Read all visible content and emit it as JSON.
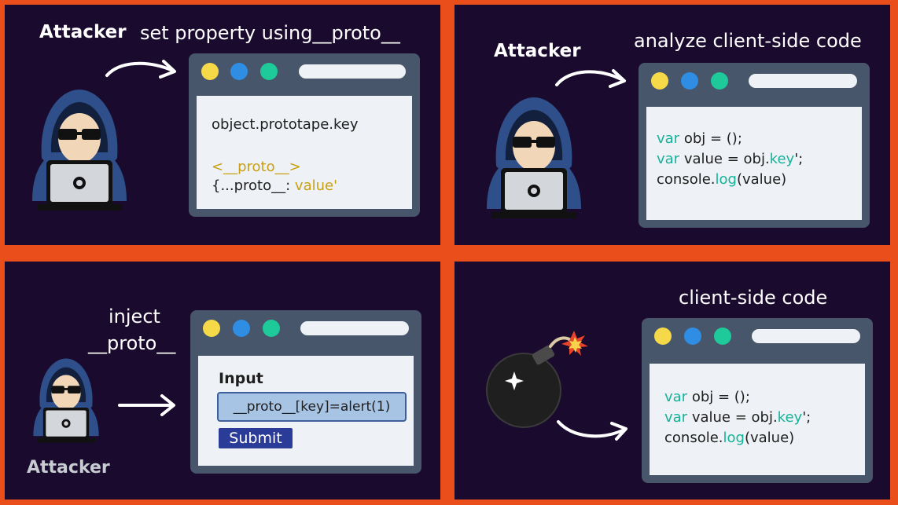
{
  "panel1": {
    "actor": "Attacker",
    "caption": "set property using__proto__",
    "code": {
      "line1": "object.prototape.key",
      "line2": "<__proto__>",
      "line3_a": "{...proto__: ",
      "line3_b": "value'"
    }
  },
  "panel2": {
    "actor": "Attacker",
    "caption": "analyze client-side code",
    "code": {
      "l1_kw": "var",
      "l1_rest": " obj = ();",
      "l2_kw": "var",
      "l2_mid": " value = obj.",
      "l2_key": "key",
      "l2_end": "';",
      "l3_a": "console.",
      "l3_log": "log",
      "l3_b": "(value)"
    }
  },
  "panel3": {
    "caption_line1": "inject",
    "caption_line2": "__proto__",
    "actor": "Attacker",
    "form": {
      "input_label": "Input",
      "input_value": "__proto__[key]=alert(1)",
      "submit_label": "Submit"
    }
  },
  "panel4": {
    "caption": "client-side code",
    "code": {
      "l1_kw": "var",
      "l1_rest": " obj = ();",
      "l2_kw": "var",
      "l2_mid": " value = obj.",
      "l2_key": "key",
      "l2_end": "';",
      "l3_a": "console.",
      "l3_log": "log",
      "l3_b": "(value)"
    }
  },
  "colors": {
    "divider": "#e94e1b",
    "panel_bg": "#1a0b2e",
    "window_frame": "#47566a",
    "dot_yellow": "#f5d949",
    "dot_blue": "#2f8de4",
    "dot_green": "#1ec99a",
    "keyword": "#14b39a",
    "proto_text": "#c8a012",
    "hood": "#2f4f8a",
    "submit": "#2b3b98"
  }
}
